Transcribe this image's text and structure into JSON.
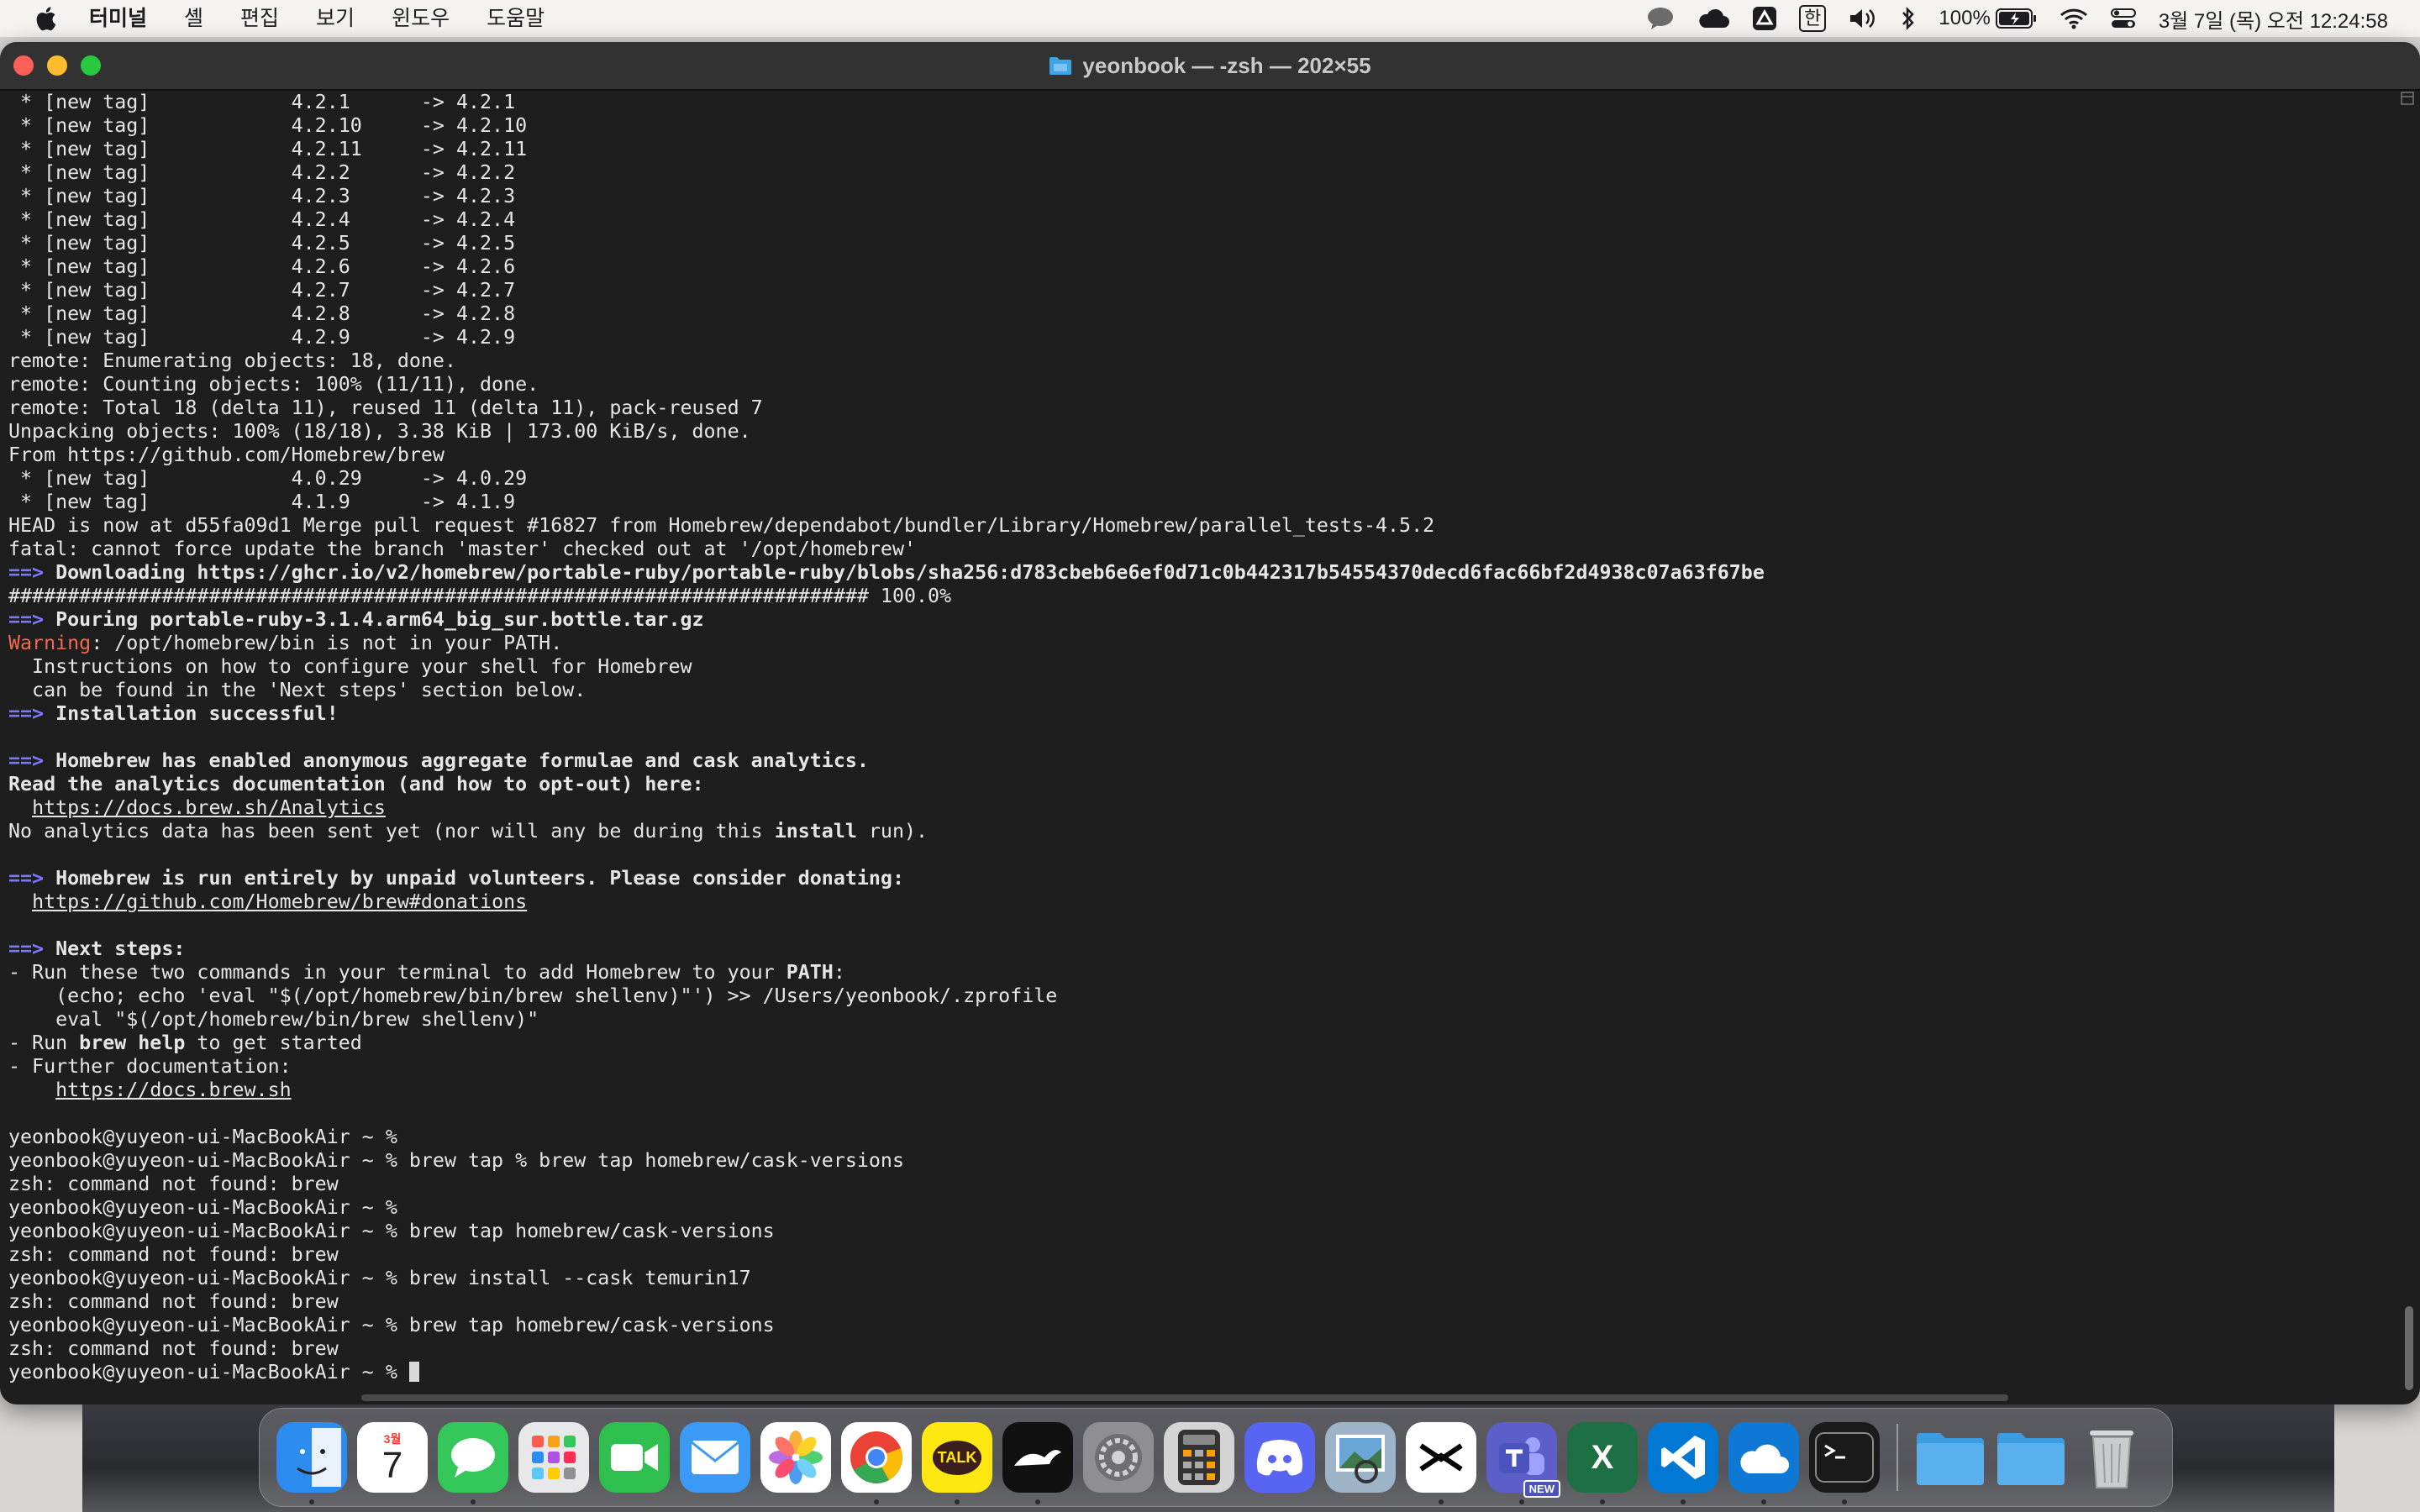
{
  "menubar": {
    "app_name": "터미널",
    "items": [
      "셸",
      "편집",
      "보기",
      "윈도우",
      "도움말"
    ],
    "battery": "100%",
    "input_mode": "한",
    "datetime": "3월 7일 (목) 오전 12:24:58"
  },
  "window": {
    "title": "yeonbook — -zsh — 202×55"
  },
  "terminal": {
    "lines": [
      [
        {
          "t": " * [new tag]            4.2.1      -> 4.2.1"
        }
      ],
      [
        {
          "t": " * [new tag]            4.2.10     -> 4.2.10"
        }
      ],
      [
        {
          "t": " * [new tag]            4.2.11     -> 4.2.11"
        }
      ],
      [
        {
          "t": " * [new tag]            4.2.2      -> 4.2.2"
        }
      ],
      [
        {
          "t": " * [new tag]            4.2.3      -> 4.2.3"
        }
      ],
      [
        {
          "t": " * [new tag]            4.2.4      -> 4.2.4"
        }
      ],
      [
        {
          "t": " * [new tag]            4.2.5      -> 4.2.5"
        }
      ],
      [
        {
          "t": " * [new tag]            4.2.6      -> 4.2.6"
        }
      ],
      [
        {
          "t": " * [new tag]            4.2.7      -> 4.2.7"
        }
      ],
      [
        {
          "t": " * [new tag]            4.2.8      -> 4.2.8"
        }
      ],
      [
        {
          "t": " * [new tag]            4.2.9      -> 4.2.9"
        }
      ],
      [
        {
          "t": "remote: Enumerating objects: 18, done."
        }
      ],
      [
        {
          "t": "remote: Counting objects: 100% (11/11), done."
        }
      ],
      [
        {
          "t": "remote: Total 18 (delta 11), reused 11 (delta 11), pack-reused 7"
        }
      ],
      [
        {
          "t": "Unpacking objects: 100% (18/18), 3.38 KiB | 173.00 KiB/s, done."
        }
      ],
      [
        {
          "t": "From https://github.com/Homebrew/brew"
        }
      ],
      [
        {
          "t": " * [new tag]            4.0.29     -> 4.0.29"
        }
      ],
      [
        {
          "t": " * [new tag]            4.1.9      -> 4.1.9"
        }
      ],
      [
        {
          "t": "HEAD is now at d55fa09d1 Merge pull request #16827 from Homebrew/dependabot/bundler/Library/Homebrew/parallel_tests-4.5.2"
        }
      ],
      [
        {
          "t": "fatal: cannot force update the branch 'master' checked out at '/opt/homebrew'"
        }
      ],
      [
        {
          "t": "==>",
          "c": "arrow"
        },
        {
          "t": " Downloading https://ghcr.io/v2/homebrew/portable-ruby/portable-ruby/blobs/sha256:d783cbeb6e6ef0d71c0b442317b54554370decd6fac66bf2d4938c07a63f67be",
          "c": "b"
        }
      ],
      [
        {
          "t": "######################################################################### 100.0%"
        }
      ],
      [
        {
          "t": "==>",
          "c": "arrow"
        },
        {
          "t": " Pouring portable-ruby-3.1.4.arm64_big_sur.bottle.tar.gz",
          "c": "b"
        }
      ],
      [
        {
          "t": "Warning",
          "c": "warn"
        },
        {
          "t": ": /opt/homebrew/bin is not in your PATH."
        }
      ],
      [
        {
          "t": "  Instructions on how to configure your shell for Homebrew"
        }
      ],
      [
        {
          "t": "  can be found in the 'Next steps' section below."
        }
      ],
      [
        {
          "t": "==>",
          "c": "arrow"
        },
        {
          "t": " Installation successful!",
          "c": "b"
        }
      ],
      [
        {
          "t": ""
        }
      ],
      [
        {
          "t": "==>",
          "c": "arrow"
        },
        {
          "t": " Homebrew has enabled anonymous aggregate formulae and cask analytics.",
          "c": "b"
        }
      ],
      [
        {
          "t": "Read the analytics documentation (and how to opt-out) here:",
          "c": "b"
        }
      ],
      [
        {
          "t": "  "
        },
        {
          "t": "https://docs.brew.sh/Analytics",
          "c": "u"
        }
      ],
      [
        {
          "t": "No analytics data has been sent yet (nor will any be during this "
        },
        {
          "t": "install",
          "c": "b"
        },
        {
          "t": " run)."
        }
      ],
      [
        {
          "t": ""
        }
      ],
      [
        {
          "t": "==>",
          "c": "arrow"
        },
        {
          "t": " Homebrew is run entirely by unpaid volunteers. Please consider donating:",
          "c": "b"
        }
      ],
      [
        {
          "t": "  "
        },
        {
          "t": "https://github.com/Homebrew/brew#donations",
          "c": "u"
        }
      ],
      [
        {
          "t": ""
        }
      ],
      [
        {
          "t": "==>",
          "c": "arrow"
        },
        {
          "t": " Next steps:",
          "c": "b"
        }
      ],
      [
        {
          "t": "- Run these two commands in your terminal to add Homebrew to your "
        },
        {
          "t": "PATH",
          "c": "b"
        },
        {
          "t": ":"
        }
      ],
      [
        {
          "t": "    (echo; echo 'eval \"$(/opt/homebrew/bin/brew shellenv)\"') >> /Users/yeonbook/.zprofile"
        }
      ],
      [
        {
          "t": "    eval \"$(/opt/homebrew/bin/brew shellenv)\""
        }
      ],
      [
        {
          "t": "- Run "
        },
        {
          "t": "brew help",
          "c": "b"
        },
        {
          "t": " to get started"
        }
      ],
      [
        {
          "t": "- Further documentation:"
        }
      ],
      [
        {
          "t": "    "
        },
        {
          "t": "https://docs.brew.sh",
          "c": "u"
        }
      ],
      [
        {
          "t": ""
        }
      ],
      [
        {
          "t": "yeonbook@yuyeon-ui-MacBookAir ~ %"
        }
      ],
      [
        {
          "t": "yeonbook@yuyeon-ui-MacBookAir ~ % brew tap % brew tap homebrew/cask-versions"
        }
      ],
      [
        {
          "t": "zsh: command not found: brew"
        }
      ],
      [
        {
          "t": "yeonbook@yuyeon-ui-MacBookAir ~ %"
        }
      ],
      [
        {
          "t": "yeonbook@yuyeon-ui-MacBookAir ~ % brew tap homebrew/cask-versions"
        }
      ],
      [
        {
          "t": "zsh: command not found: brew"
        }
      ],
      [
        {
          "t": "yeonbook@yuyeon-ui-MacBookAir ~ % brew install --cask temurin17"
        }
      ],
      [
        {
          "t": "zsh: command not found: brew"
        }
      ],
      [
        {
          "t": "yeonbook@yuyeon-ui-MacBookAir ~ % brew tap homebrew/cask-versions"
        }
      ],
      [
        {
          "t": "zsh: command not found: brew"
        }
      ],
      [
        {
          "t": "yeonbook@yuyeon-ui-MacBookAir ~ % "
        },
        {
          "t": "",
          "c": "cursor"
        }
      ]
    ]
  },
  "dock": {
    "calendar_month": "3월",
    "calendar_day": "7",
    "kakao_label": "TALK",
    "teams_badge": "NEW",
    "excel_letter": "X",
    "items": [
      {
        "name": "finder",
        "color": "#2d8cf0"
      },
      {
        "name": "calendar",
        "color": "#ffffff"
      },
      {
        "name": "messages",
        "color": "#34c759"
      },
      {
        "name": "launchpad",
        "color": "#e8e8ea"
      },
      {
        "name": "facetime",
        "color": "#2fbf4f"
      },
      {
        "name": "mail",
        "color": "#3b9af5"
      },
      {
        "name": "photos",
        "color": "#ffffff"
      },
      {
        "name": "chrome",
        "color": "#ffffff"
      },
      {
        "name": "kakaotalk",
        "color": "#ffe812"
      },
      {
        "name": "genie",
        "color": "#111111"
      },
      {
        "name": "system-settings",
        "color": "#8e8e93"
      },
      {
        "name": "calculator",
        "color": "#d4d4d4"
      },
      {
        "name": "discord",
        "color": "#5865f2"
      },
      {
        "name": "preview",
        "color": "#9db4c8"
      },
      {
        "name": "capcut",
        "color": "#ffffff"
      },
      {
        "name": "teams",
        "color": "#5b5fc7"
      },
      {
        "name": "excel",
        "color": "#1d7044"
      },
      {
        "name": "vscode",
        "color": "#0078d4"
      },
      {
        "name": "onedrive",
        "color": "#0f78d4"
      },
      {
        "name": "terminal",
        "color": "#1a1a1a"
      }
    ],
    "stacks": [
      {
        "name": "documents-folder",
        "color": "#5ab0ef"
      },
      {
        "name": "downloads-folder",
        "color": "#5ab0ef"
      },
      {
        "name": "trash",
        "color": "#c9cbcd"
      }
    ]
  }
}
